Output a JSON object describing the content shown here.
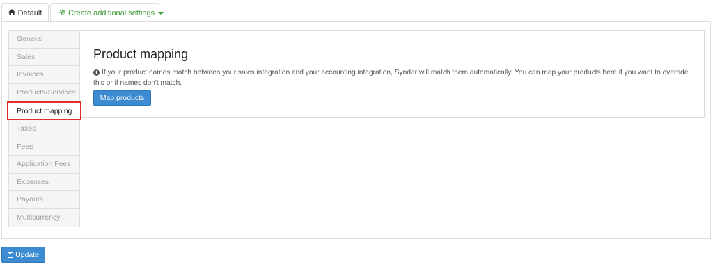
{
  "tabs": {
    "default": {
      "label": "Default",
      "icon": "home-icon"
    },
    "additional": {
      "label": "Create additional settings",
      "icon": "gear-icon"
    }
  },
  "sidebar": {
    "items": [
      {
        "label": "General"
      },
      {
        "label": "Sales"
      },
      {
        "label": "Invoices"
      },
      {
        "label": "Products/Services"
      },
      {
        "label": "Product mapping",
        "selected": true
      },
      {
        "label": "Taxes"
      },
      {
        "label": "Fees"
      },
      {
        "label": "Application Fees"
      },
      {
        "label": "Expenses"
      },
      {
        "label": "Payouts"
      },
      {
        "label": "Multicurrency"
      }
    ]
  },
  "main": {
    "title": "Product mapping",
    "info_text": "If your product names match between your sales integration and your accounting integration, Synder will match them automatically. You can map your products here if you want to override this or if names don't match.",
    "map_button_label": "Map products"
  },
  "footer": {
    "update_label": "Update"
  },
  "colors": {
    "accent": "#3d8bd0",
    "link_green": "#3c9a36",
    "highlight_red": "#e12d2d"
  }
}
